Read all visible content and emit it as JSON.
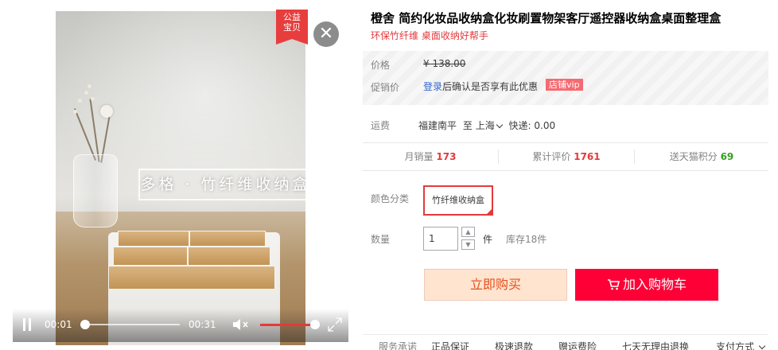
{
  "video": {
    "caption": "多格 · 竹纤维收纳盒",
    "badge": "公益\n宝贝",
    "badge_line1": "公益",
    "badge_line2": "宝贝",
    "current_time": "00:01",
    "duration": "00:31",
    "progress_fraction": 0.03,
    "volume_fraction": 0.95
  },
  "product": {
    "title": "橙舍 简约化妆品收纳盒化妆刷置物架客厅遥控器收纳盒桌面整理盒",
    "subtitle": "环保竹纤维 桌面收纳好帮手"
  },
  "price": {
    "price_label": "价格",
    "price_value": "¥ 138.00",
    "promo_label": "促销价",
    "login_link": "登录",
    "promo_text": "后确认是否享有此优惠",
    "vip_tag": "店铺vip"
  },
  "shipping": {
    "label": "运费",
    "from": "福建南平",
    "to_word": "至",
    "to": "上海",
    "express": "快递: 0.00"
  },
  "stats": {
    "monthly_label": "月销量",
    "monthly_value": "173",
    "reviews_label": "累计评价",
    "reviews_value": "1761",
    "points_label": "送天猫积分",
    "points_value": "69"
  },
  "sku": {
    "color_label": "颜色分类",
    "color_option": "竹纤维收纳盒",
    "qty_label": "数量",
    "qty_value": "1",
    "qty_unit": "件",
    "stock": "库存18件"
  },
  "actions": {
    "buy_now": "立即购买",
    "add_to_cart": "加入购物车"
  },
  "services": {
    "label": "服务承诺",
    "items": [
      "正品保证",
      "极速退款",
      "赠运费险",
      "七天无理由退换"
    ],
    "payment": "支付方式"
  },
  "colors": {
    "accent": "#e4393c",
    "cart": "#ff0036",
    "buy_bg": "#ffe4d0",
    "buy_text": "#e5511d",
    "link": "#3366cc",
    "points": "#3a9d23"
  }
}
